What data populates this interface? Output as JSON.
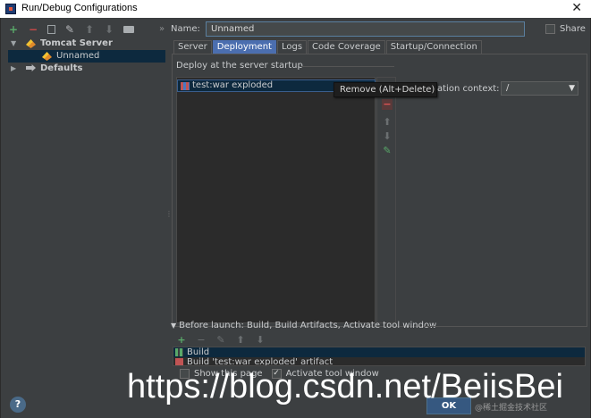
{
  "window": {
    "title": "Run/Debug Configurations",
    "close_glyph": "✕"
  },
  "left_toolbar": {
    "icons": [
      "plus-icon",
      "minus-icon",
      "copy-icon",
      "wrench-icon",
      "arrow-up-icon",
      "arrow-down-icon",
      "folder-icon"
    ],
    "more_glyph": "»"
  },
  "tree": {
    "items": [
      {
        "label": "Tomcat Server",
        "expanded": true
      },
      {
        "label": "Unnamed",
        "selected": true
      },
      {
        "label": "Defaults",
        "expanded": false
      }
    ]
  },
  "config": {
    "name_label": "Name:",
    "name_value": "Unnamed",
    "share_label": "Share",
    "share_checked": false
  },
  "tabs": [
    {
      "label": "Server",
      "active": false
    },
    {
      "label": "Deployment",
      "active": true
    },
    {
      "label": "Logs",
      "active": false
    },
    {
      "label": "Code Coverage",
      "active": false
    },
    {
      "label": "Startup/Connection",
      "active": false
    }
  ],
  "deployment": {
    "section_title": "Deploy at the server startup",
    "artifacts": [
      "test:war exploded"
    ],
    "tooltip": "Remove (Alt+Delete)",
    "context_label": "ation context:",
    "context_value": "/"
  },
  "before_launch": {
    "title": "Before launch: Build, Build Artifacts, Activate tool window",
    "items": [
      "Build",
      "Build 'test:war exploded' artifact"
    ],
    "show_page_label": "Show this page",
    "show_page_checked": false,
    "activate_label": "Activate tool window",
    "activate_checked": true
  },
  "footer": {
    "help_label": "?",
    "ok_label": "OK",
    "small_watermark": "@稀土掘金技术社区"
  },
  "watermark_text": "https://blog.csdn.net/BeiisBei",
  "colors": {
    "background": "#3c3f41",
    "selection": "#0d293e",
    "tab_active": "#4b6eaf",
    "ok_button": "#365880"
  }
}
